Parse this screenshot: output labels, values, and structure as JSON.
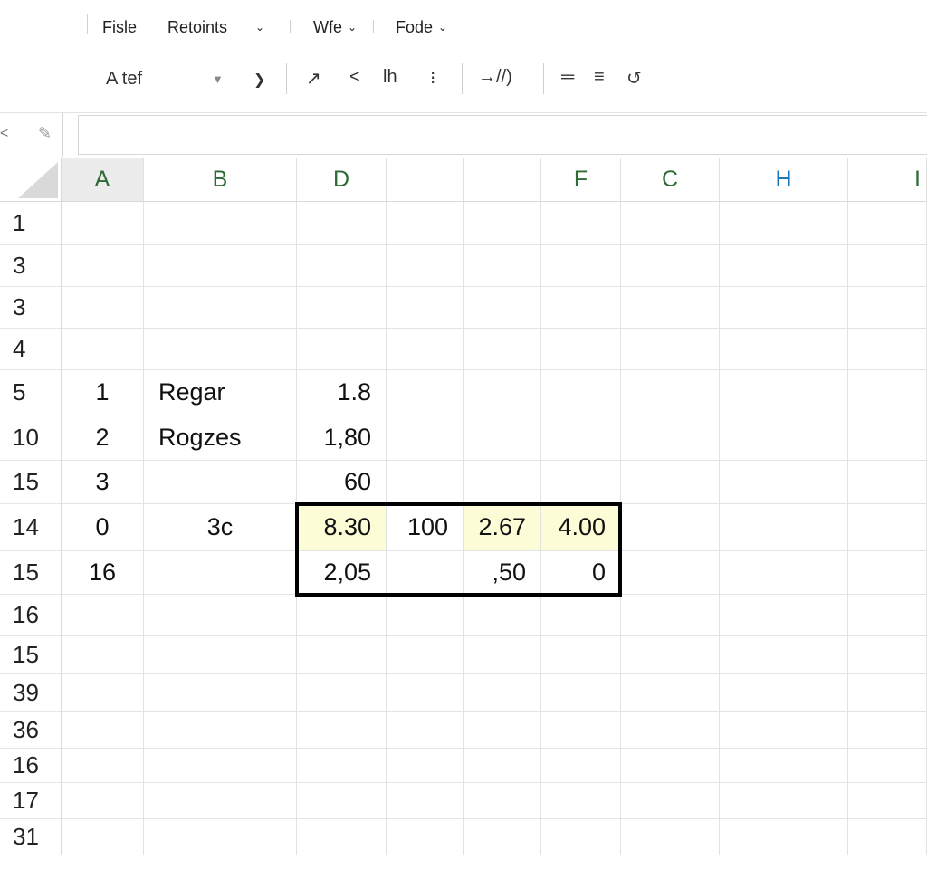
{
  "menu": {
    "file": "Fisle",
    "retoints": "Retoints",
    "wfe": "Wfe",
    "fode": "Fode"
  },
  "toolbar": {
    "font_name": "A tef",
    "icons": [
      "dropdown-arrow-icon",
      "chevron-down-icon",
      "expand-arrow-icon",
      "chevron-left-icon",
      "bar-chart-icon",
      "more-vertical-icon",
      "indent-arrow-icon",
      "align-icon",
      "wrap-icon",
      "undo-icon"
    ],
    "labels": {
      "expand": "↗",
      "back": "<",
      "bars": "lh",
      "more": "⁝",
      "indent": "→//)",
      "align": "═",
      "wrap": "≡",
      "undo": "↺"
    }
  },
  "formula_bar": {
    "name_box_prefix": "<",
    "value": ""
  },
  "columns": [
    "A",
    "B",
    "D",
    "",
    "",
    "F",
    "C",
    "H",
    "I"
  ],
  "rows": [
    {
      "header": "1",
      "cells": {}
    },
    {
      "header": "3",
      "cells": {}
    },
    {
      "header": "3",
      "cells": {}
    },
    {
      "header": "4",
      "cells": {}
    },
    {
      "header": "5",
      "cells": {
        "A": "1",
        "B": "Regar",
        "D": "1.8"
      }
    },
    {
      "header": "10",
      "cells": {
        "A": "2",
        "B": "Rogzes",
        "D": "1,80"
      }
    },
    {
      "header": "15",
      "cells": {
        "A": "3",
        "D": "60"
      }
    },
    {
      "header": "14",
      "cells": {
        "A": "0",
        "B": "3c",
        "D": "8.30",
        "E": "100",
        "F2": "2.67",
        "F": "4.00"
      }
    },
    {
      "header": "15",
      "cells": {
        "A": "16",
        "D": "2,05",
        "F2": ",50",
        "F": "0"
      }
    },
    {
      "header": "16",
      "cells": {}
    },
    {
      "header": "15",
      "cells": {}
    },
    {
      "header": "39",
      "cells": {}
    },
    {
      "header": "36",
      "cells": {}
    },
    {
      "header": "16",
      "cells": {}
    },
    {
      "header": "17",
      "cells": {}
    },
    {
      "header": "31",
      "cells": {}
    }
  ],
  "highlight_color": "#fcfcd6",
  "header_text_color": "#2e6b34"
}
